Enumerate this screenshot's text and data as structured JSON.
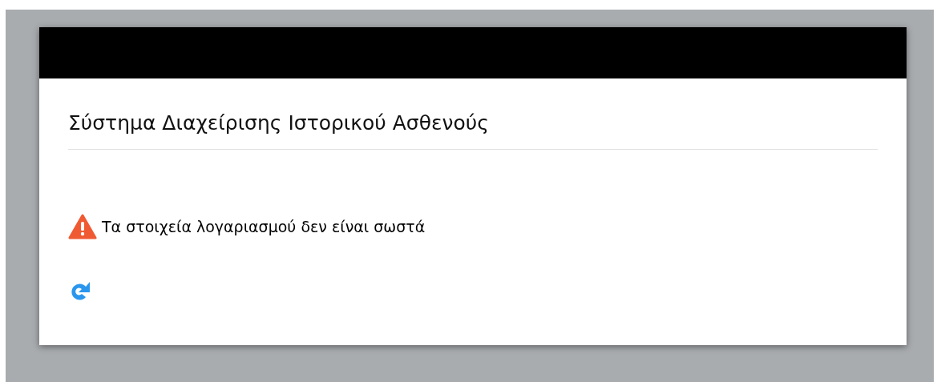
{
  "title": "Σύστημα Διαχείρισης Ιστορικού Ασθενούς",
  "alert": {
    "kind": "error",
    "message": "Τα στοιχεία λογαριασμού δεν είναι σωστά"
  }
}
